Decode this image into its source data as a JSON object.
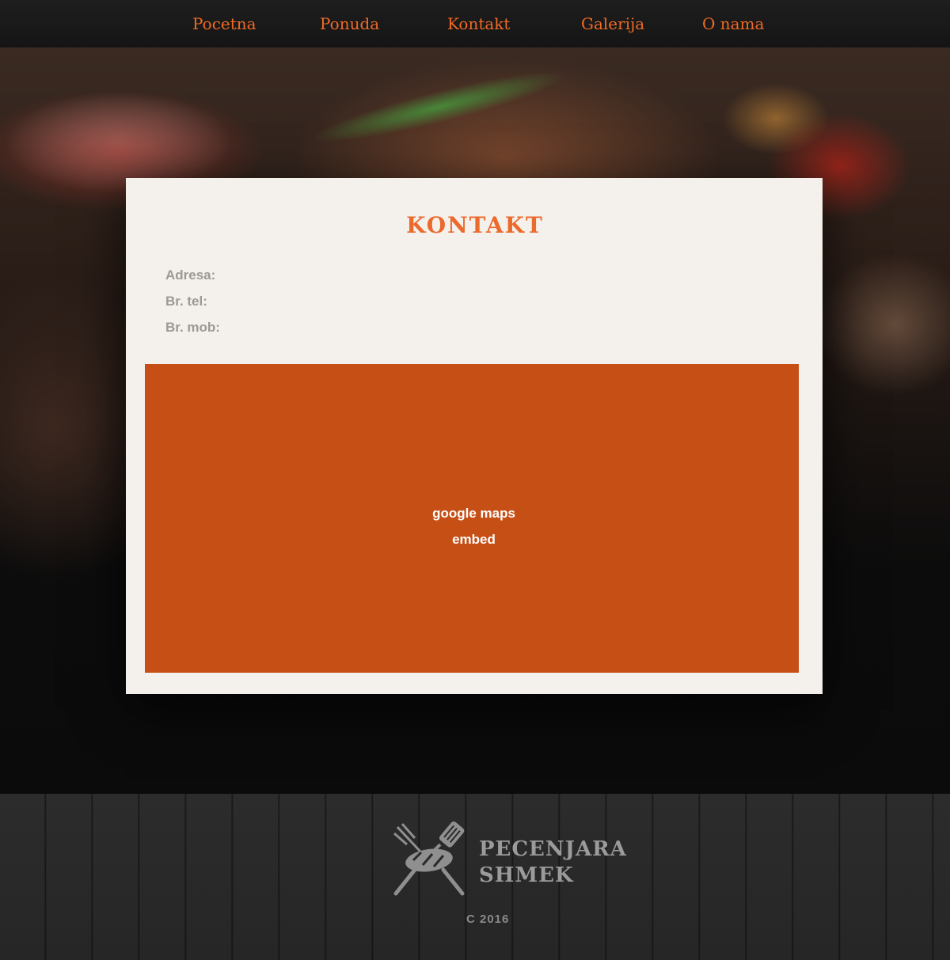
{
  "nav": {
    "items": [
      {
        "label": "Pocetna"
      },
      {
        "label": "Ponuda"
      },
      {
        "label": "Kontakt"
      },
      {
        "label": "Galerija"
      },
      {
        "label": "O nama"
      }
    ]
  },
  "contact": {
    "title": "KONTAKT",
    "address_label": "Adresa:",
    "phone_label": "Br. tel:",
    "mobile_label": "Br. mob:"
  },
  "map": {
    "line1": "google maps",
    "line2": "embed",
    "color": "#c64f16"
  },
  "footer": {
    "brand_line1": "PECENJARA",
    "brand_line2": "SHMEK",
    "logo_icon": "grill-utensils-icon",
    "copyright": "C 2016"
  },
  "colors": {
    "accent": "#ec6a2b",
    "card_bg": "#f4f0ec",
    "nav_bg": "#1b1b1b"
  }
}
